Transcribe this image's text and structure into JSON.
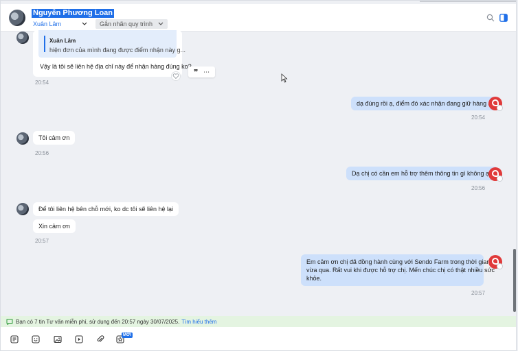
{
  "header": {
    "contact_name": "Nguyễn Phương Loan",
    "assignee": "Xuân Lâm",
    "tag_button": "Gắn nhãn quy trình"
  },
  "messages": {
    "quoted_name": "Xuân Lâm",
    "quoted_text": "hiện đơn của mình đang được điểm nhận này g...",
    "m1_text": "Vậy là tôi sẽ liên hệ địa chỉ này để nhận hàng đúng ko?",
    "m1_time": "20:54",
    "m2_text": "dạ đúng rồi ạ, điểm đó xác nhận đang giữ hàng ạ",
    "m2_time": "20:54",
    "m3_text": "Tôi cảm ơn",
    "m3_time": "20:56",
    "m4_text": "Dạ chị có cần em hỗ trợ thêm thông tin gì không ạ?",
    "m4_time": "20:56",
    "m5_text": "Để tôi liên hệ bên chỗ mới, ko dc tôi sẽ liên hệ lại",
    "m6_text": "Xin cảm ơn",
    "m6_time": "20:57",
    "m7_line1": "Em cảm ơn chị đã đồng hành cùng với Sendo Farm trong thời gian",
    "m7_line2": "vừa qua. Rất vui khi được hỗ trợ chị. Mến chúc chị có thật nhiều sức",
    "m7_line3": "khỏe.",
    "m7_time": "20:57"
  },
  "notice": {
    "text": "Bạn có 7 tin Tư vấn miễn phí, sử dụng đến 20:57 ngày 30/07/2025.",
    "link": "Tìm hiểu thêm"
  },
  "toolbar": {
    "new_badge": "MỚI"
  },
  "colors": {
    "accent": "#1f6fe8",
    "outgoing_bubble": "#cde0fb",
    "notice_bg": "#e4f4e1",
    "shop_avatar": "#e03a3a"
  }
}
